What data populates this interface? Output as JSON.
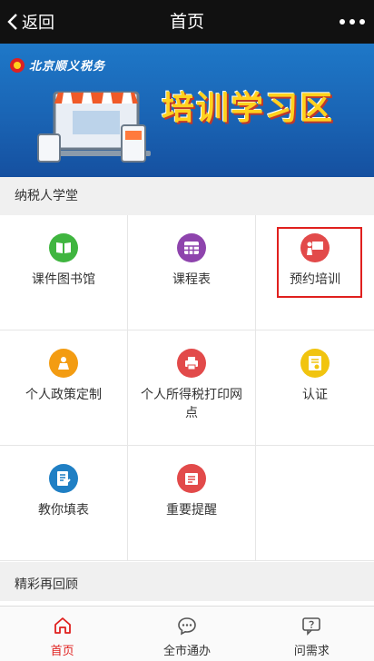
{
  "header": {
    "back_label": "返回",
    "title": "首页"
  },
  "banner": {
    "org_name": "北京顺义税务",
    "heading": "培训学习区"
  },
  "sections": {
    "school_title": "纳税人学堂",
    "review_title": "精彩再回顾"
  },
  "grid": [
    {
      "label": "课件图书馆",
      "icon": "book-icon",
      "color": "#3fb53f"
    },
    {
      "label": "课程表",
      "icon": "schedule-icon",
      "color": "#8e44ad"
    },
    {
      "label": "预约培训",
      "icon": "training-icon",
      "color": "#e24a4a"
    },
    {
      "label": "个人政策定制",
      "icon": "person-policy-icon",
      "color": "#f39c12"
    },
    {
      "label": "个人所得税打印网点",
      "icon": "print-point-icon",
      "color": "#e24a4a"
    },
    {
      "label": "认证",
      "icon": "certificate-icon",
      "color": "#f1c40f"
    },
    {
      "label": "教你填表",
      "icon": "form-icon",
      "color": "#1f7fc4"
    },
    {
      "label": "重要提醒",
      "icon": "reminder-icon",
      "color": "#e24a4a"
    }
  ],
  "tabs": [
    {
      "label": "首页",
      "icon": "home-icon",
      "active": true
    },
    {
      "label": "全市通办",
      "icon": "chat-icon",
      "active": false
    },
    {
      "label": "问需求",
      "icon": "question-icon",
      "active": false
    }
  ],
  "colors": {
    "accent": "#e0201e",
    "header_bg": "#111111"
  }
}
